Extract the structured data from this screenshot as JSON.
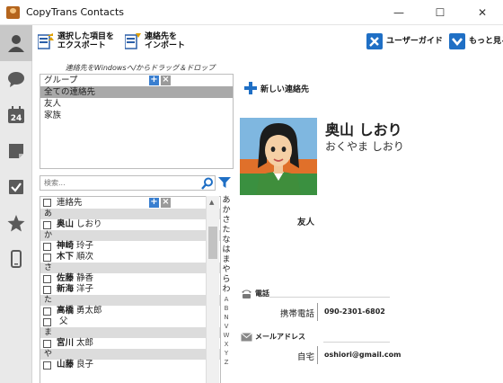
{
  "window": {
    "title": "CopyTrans Contacts",
    "minimize": "—",
    "maximize": "☐",
    "close": "✕"
  },
  "rail": {
    "items": [
      "contacts-icon",
      "messages-icon",
      "calendar-icon",
      "notes-icon",
      "tasks-icon",
      "favorites-icon",
      "device-icon"
    ],
    "calendar_number": "24",
    "active_color": "#c8c8c8"
  },
  "toolbar": {
    "export_label": "選択した項目を\nエクスポート",
    "import_label": "連絡先を\nインポート",
    "guide_label": "ユーザーガイド",
    "more_label": "もっと見る"
  },
  "hint": "連絡先をWindowsへ/からドラッグ＆ドロップ",
  "groups": {
    "header": "グループ",
    "items": [
      "全ての連絡先",
      "友人",
      "家族"
    ],
    "selected_index": 0
  },
  "search": {
    "placeholder": "検索..."
  },
  "contacts": {
    "header": "連絡先",
    "rows": [
      {
        "kind": "letter",
        "text": "あ"
      },
      {
        "kind": "contact",
        "last": "奥山",
        "first": "しおり"
      },
      {
        "kind": "letter",
        "text": "か"
      },
      {
        "kind": "contact",
        "last": "神崎",
        "first": "玲子"
      },
      {
        "kind": "contact",
        "last": "木下",
        "first": "順次"
      },
      {
        "kind": "letter",
        "text": "さ"
      },
      {
        "kind": "contact",
        "last": "佐藤",
        "first": "静香"
      },
      {
        "kind": "contact",
        "last": "新海",
        "first": "洋子"
      },
      {
        "kind": "letter",
        "text": "た"
      },
      {
        "kind": "contact",
        "last": "高橋",
        "first": "勇太郎"
      },
      {
        "kind": "contact",
        "last": "",
        "first": "父"
      },
      {
        "kind": "letter",
        "text": "ま"
      },
      {
        "kind": "contact",
        "last": "宮川",
        "first": "太郎"
      },
      {
        "kind": "letter",
        "text": "や"
      },
      {
        "kind": "contact",
        "last": "山藤",
        "first": "良子"
      }
    ],
    "index_kana": [
      "あ",
      "か",
      "さ",
      "た",
      "な",
      "は",
      "ま",
      "や",
      "ら",
      "わ"
    ],
    "index_latin": [
      "A",
      "B",
      "N",
      "V",
      "W",
      "X",
      "Y",
      "Z"
    ]
  },
  "detail": {
    "new_contact_label": "新しい連絡先",
    "name": "奥山 しおり",
    "kana": "おくやま しおり",
    "group": "友人",
    "phone_section": "電話",
    "phone_key": "携帯電話",
    "phone_value": "090-2301-6802",
    "email_section": "メールアドレス",
    "email_key": "自宅",
    "email_value": "oshiori@gmail.com"
  },
  "colors": {
    "accent_blue": "#1f6fc5",
    "selected_gray": "#a9a9a9",
    "letter_row_gray": "#dcdcdc"
  }
}
